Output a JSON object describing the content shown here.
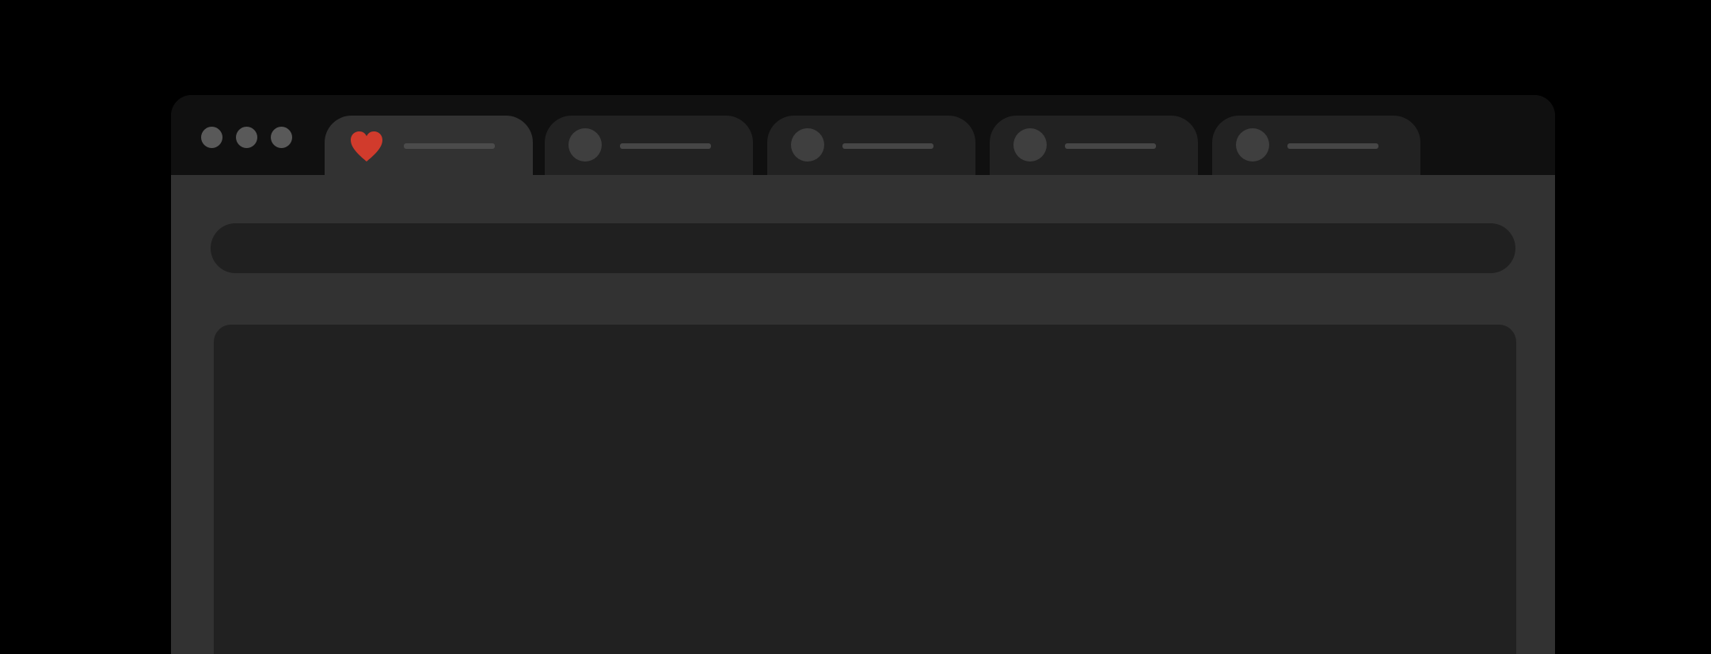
{
  "window": {
    "traffic_lights": [
      "close",
      "minimize",
      "maximize"
    ],
    "colors": {
      "background": "#000000",
      "titlebar": "#101010",
      "tab_active": "#323232",
      "tab_inactive": "#222222",
      "content": "#323232",
      "address_bar": "#202020",
      "page_area": "#212121",
      "accent_heart": "#d13b2c"
    }
  },
  "tabs": [
    {
      "icon": "heart-icon",
      "active": true
    },
    {
      "icon": "circle-icon",
      "active": false
    },
    {
      "icon": "circle-icon",
      "active": false
    },
    {
      "icon": "circle-icon",
      "active": false
    },
    {
      "icon": "circle-icon",
      "active": false
    }
  ],
  "address_bar": {
    "value": ""
  }
}
